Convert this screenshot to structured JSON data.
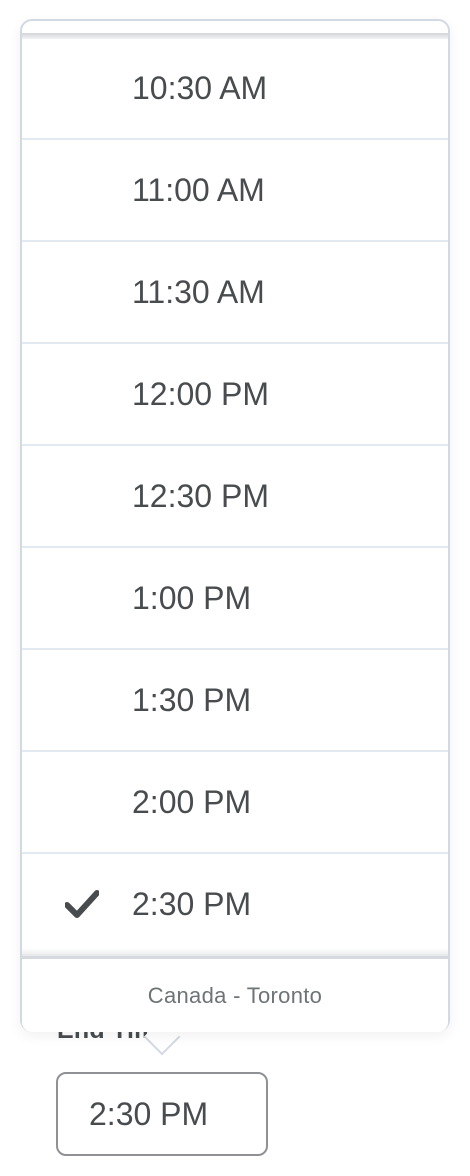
{
  "field": {
    "label": "End Time",
    "value": "2:30 PM"
  },
  "dropdown": {
    "options": [
      {
        "label": "10:30 AM",
        "selected": false
      },
      {
        "label": "11:00 AM",
        "selected": false
      },
      {
        "label": "11:30 AM",
        "selected": false
      },
      {
        "label": "12:00 PM",
        "selected": false
      },
      {
        "label": "12:30 PM",
        "selected": false
      },
      {
        "label": "1:00 PM",
        "selected": false
      },
      {
        "label": "1:30 PM",
        "selected": false
      },
      {
        "label": "2:00 PM",
        "selected": false
      },
      {
        "label": "2:30 PM",
        "selected": true
      }
    ],
    "timezone": "Canada - Toronto"
  },
  "colors": {
    "text": "#494c4e",
    "border": "#d3d9e3",
    "divider": "#e3e9f1"
  },
  "icons": {
    "selected": "checkmark-icon"
  }
}
